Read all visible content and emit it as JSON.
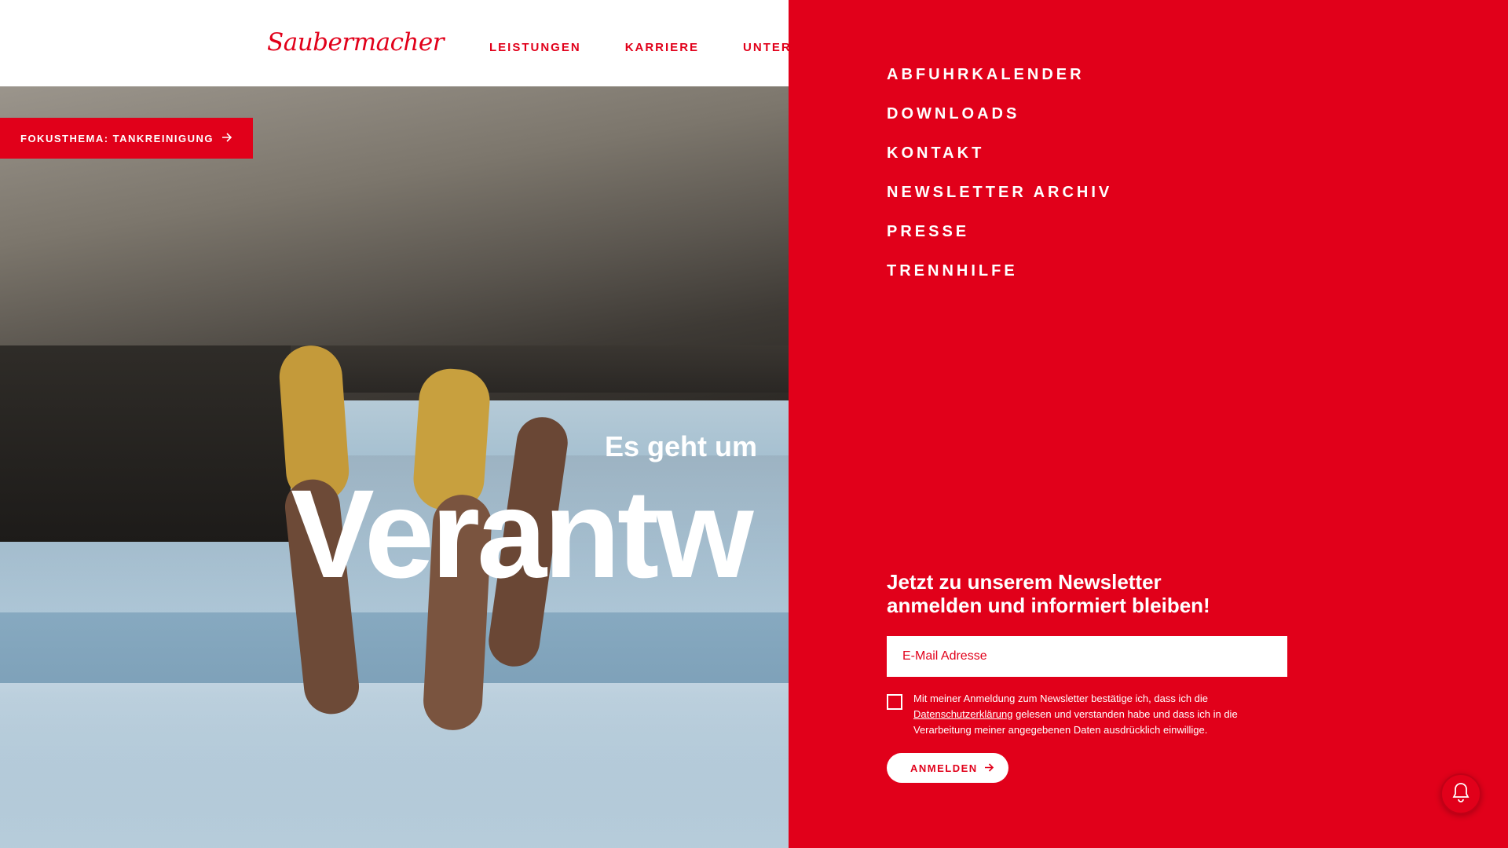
{
  "header": {
    "logo": "Saubermacher",
    "nav": [
      "LEISTUNGEN",
      "KARRIERE",
      "UNTERN"
    ]
  },
  "hero": {
    "focus_button": "FOKUSTHEMA: TANKREINIGUNG",
    "tagline": "Es geht um",
    "headline": "Verantw"
  },
  "panel": {
    "menu": [
      "ABFUHRKALENDER",
      "DOWNLOADS",
      "KONTAKT",
      "NEWSLETTER ARCHIV",
      "PRESSE",
      "TRENNHILFE"
    ],
    "newsletter": {
      "title_line1": "Jetzt zu unserem Newsletter",
      "title_line2": "anmelden und informiert bleiben!",
      "email_placeholder": "E-Mail Adresse",
      "consent_before": "Mit meiner Anmeldung zum Newsletter bestätige ich, dass ich die ",
      "consent_link": "Datenschutzerklärung",
      "consent_after": " gelesen und verstanden habe und dass ich in die Verarbeitung meiner angegebenen Daten ausdrücklich einwillige.",
      "submit": "ANMELDEN"
    }
  },
  "icons": {
    "arrow": "arrow-right-icon",
    "bell": "bell-icon"
  },
  "colors": {
    "brand_red": "#e1001a",
    "white": "#ffffff"
  }
}
